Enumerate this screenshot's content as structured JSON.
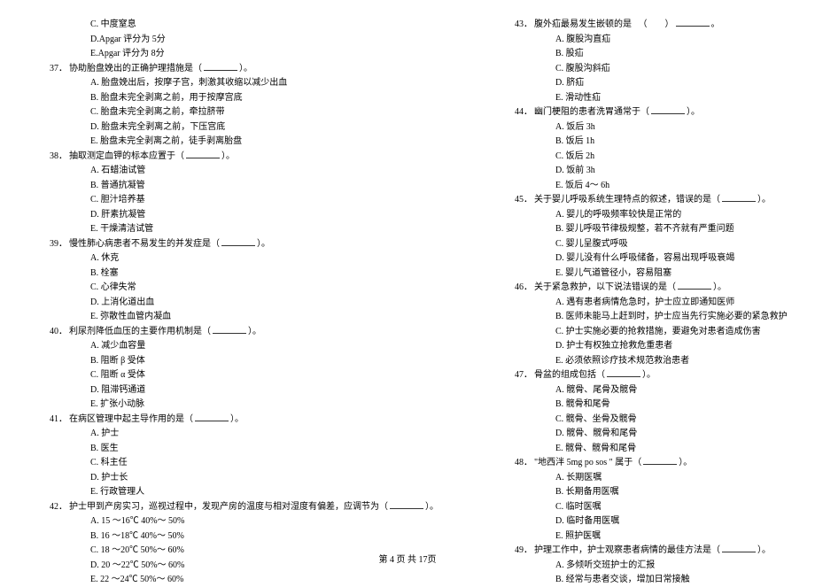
{
  "left": {
    "pre_options": [
      "C. 中度窒息",
      "D.Apgar 评分为 5分",
      "E.Apgar 评分为 8分"
    ],
    "questions": [
      {
        "num": "37．",
        "stem_pre": "协助胎盘娩出的正确护理措施是（",
        "stem_post": "）。",
        "options": [
          "A.  胎盘娩出后，按摩子宫，刺激其收缩以减少出血",
          "B.  胎盘未完全剥离之前，用于按摩宫底",
          "C.  胎盘未完全剥离之前，牵拉脐带",
          "D.  胎盘未完全剥离之前，下压宫底",
          "E.  胎盘未完全剥离之前，徒手剥离胎盘"
        ]
      },
      {
        "num": "38．",
        "stem_pre": "抽取测定血钾的标本应置于（",
        "stem_post": "）。",
        "options": [
          "A. 石蜡油试管",
          "B.  普通抗凝管",
          "C.  胆汁培养基",
          "D.  肝素抗凝管",
          "E.  干燥清洁试管"
        ]
      },
      {
        "num": "39．",
        "stem_pre": "慢性肺心病患者不易发生的并发症是（",
        "stem_post": "）。",
        "options": [
          "A. 休克",
          "B. 栓塞",
          "C. 心律失常",
          "D. 上消化道出血",
          "E. 弥散性血管内凝血"
        ]
      },
      {
        "num": "40．",
        "stem_pre": "利尿剂降低血压的主要作用机制是（",
        "stem_post": "）。",
        "options": [
          "A. 减少血容量",
          "B. 阻断 β 受体",
          "C. 阻断 α 受体",
          "D. 阻滞钙通道",
          "E. 扩张小动脉"
        ]
      },
      {
        "num": "41．",
        "stem_pre": "在病区管理中起主导作用的是（",
        "stem_post": "）。",
        "options": [
          "A.  护士",
          "B.  医生",
          "C.  科主任",
          "D.  护士长",
          "E.  行政管理人"
        ]
      },
      {
        "num": "42．",
        "stem_pre": "护士甲到产房实习，巡视过程中，发现产房的温度与相对湿度有偏差，应调节为（",
        "stem_post": "）。",
        "options": [
          "A. 15 ～16℃ 40%～  50%",
          "B. 16 ～18℃ 40%～  50%",
          "C. 18 ～20℃ 50%～  60%",
          "D. 20 ～22℃ 50%～  60%",
          "E. 22 ～24℃ 50%～  60%"
        ]
      }
    ]
  },
  "right": {
    "questions": [
      {
        "num": "43．",
        "stem_pre": "腹外疝最易发生嵌顿的是 　（　　）",
        "stem_post": "。",
        "options": [
          "A.  腹股沟直疝",
          "B.  股疝",
          "C.  腹股沟斜疝",
          "D. 脐疝",
          "E.  滑动性疝"
        ]
      },
      {
        "num": "44．",
        "stem_pre": "幽门梗阻的患者洗胃通常于（",
        "stem_post": "）。",
        "options": [
          "A.  饭后 3h",
          "B.  饭后 1h",
          "C.  饭后 2h",
          "D.  饭前 3h",
          "E.  饭后 4～ 6h"
        ]
      },
      {
        "num": "45．",
        "stem_pre": "关于婴儿呼吸系统生理特点的叙述，错误的是（",
        "stem_post": "）。",
        "options": [
          "A.  婴儿的呼吸频率较快是正常的",
          "B.  婴儿呼吸节律极规整，若不齐就有严重问题",
          "C.  婴儿呈腹式呼吸",
          "D.  婴儿没有什么呼吸储备，容易出现呼吸衰竭",
          "E.  婴儿气道管径小，容易阻塞"
        ]
      },
      {
        "num": "46．",
        "stem_pre": "关于紧急救护，以下说法错误的是（",
        "stem_post": "）。",
        "options": [
          "A.  遇有患者病情危急时，护士应立即通知医师",
          "B.  医师未能马上赶到时，护士应当先行实施必要的紧急救护",
          "C.  护士实施必要的抢救措施，要避免对患者造成伤害",
          "D.  护士有权独立抢救危重患者",
          "E.  必须依照诊疗技术规范救治患者"
        ]
      },
      {
        "num": "47．",
        "stem_pre": "骨盆的组成包括（",
        "stem_post": "）。",
        "options": [
          "A. 髋骨、尾骨及髋骨",
          "B. 髋骨和尾骨",
          "C. 髋骨、坐骨及髋骨",
          "D. 髋骨、髋骨和尾骨",
          "E. 髋骨、髋骨和尾骨"
        ]
      },
      {
        "num": "48．",
        "stem_pre": "\"地西泮 5mg po sos \" 属于（",
        "stem_post": "）。",
        "options": [
          "A.  长期医嘱",
          "B.  长期备用医嘱",
          "C.  临时医嘱",
          "D.  临时备用医嘱",
          "E.  照护医嘱"
        ]
      },
      {
        "num": "49．",
        "stem_pre": "护理工作中，护士观察患者病情的最佳方法是（",
        "stem_post": "）。",
        "options": [
          "A.  多倾听交班护士的汇报",
          "B.  经常与患者交谈，增加日常接触"
        ]
      }
    ]
  },
  "footer": "第  4 页  共  17页"
}
